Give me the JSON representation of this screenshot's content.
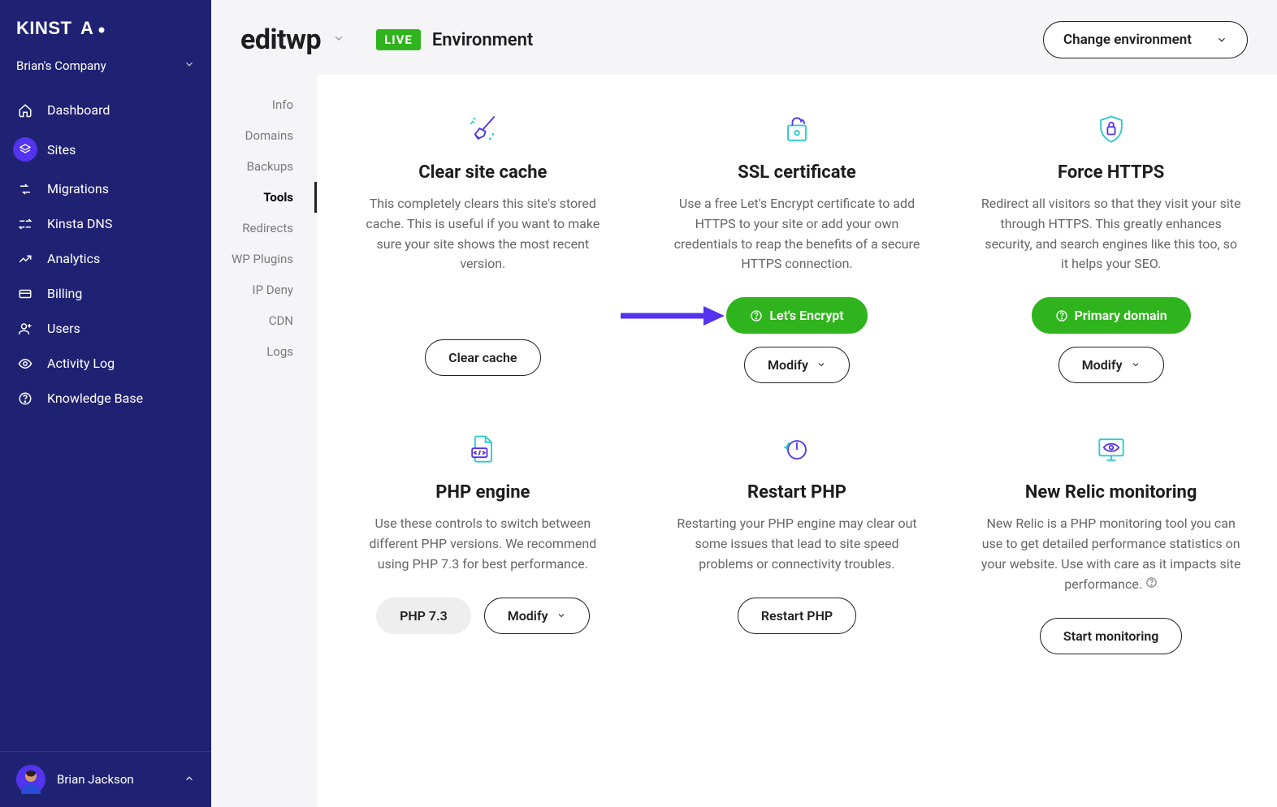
{
  "brand": "KINSTA",
  "company": {
    "name": "Brian's Company"
  },
  "nav": {
    "dashboard": "Dashboard",
    "sites": "Sites",
    "migrations": "Migrations",
    "dns": "Kinsta DNS",
    "analytics": "Analytics",
    "billing": "Billing",
    "users": "Users",
    "activity": "Activity Log",
    "kb": "Knowledge Base"
  },
  "user": {
    "name": "Brian Jackson"
  },
  "header": {
    "site_title": "editwp",
    "live_badge": "LIVE",
    "environment_label": "Environment",
    "change_env": "Change environment"
  },
  "subnav": [
    {
      "label": "Info",
      "active": false
    },
    {
      "label": "Domains",
      "active": false
    },
    {
      "label": "Backups",
      "active": false
    },
    {
      "label": "Tools",
      "active": true
    },
    {
      "label": "Redirects",
      "active": false
    },
    {
      "label": "WP Plugins",
      "active": false
    },
    {
      "label": "IP Deny",
      "active": false
    },
    {
      "label": "CDN",
      "active": false
    },
    {
      "label": "Logs",
      "active": false
    }
  ],
  "tools": {
    "clear_cache": {
      "title": "Clear site cache",
      "desc": "This completely clears this site's stored cache. This is useful if you want to make sure your site shows the most recent version.",
      "button": "Clear cache"
    },
    "ssl": {
      "title": "SSL certificate",
      "desc": "Use a free Let's Encrypt certificate to add HTTPS to your site or add your own credentials to reap the benefits of a secure HTTPS connection.",
      "primary_button": "Let's Encrypt",
      "secondary_button": "Modify"
    },
    "force_https": {
      "title": "Force HTTPS",
      "desc": "Redirect all visitors so that they visit your site through HTTPS. This greatly enhances security, and search engines like this too, so it helps your SEO.",
      "primary_button": "Primary domain",
      "secondary_button": "Modify"
    },
    "php_engine": {
      "title": "PHP engine",
      "desc": "Use these controls to switch between different PHP versions. We recommend using PHP 7.3 for best performance.",
      "chip": "PHP 7.3",
      "button": "Modify"
    },
    "restart_php": {
      "title": "Restart PHP",
      "desc": "Restarting your PHP engine may clear out some issues that lead to site speed problems or connectivity troubles.",
      "button": "Restart PHP"
    },
    "new_relic": {
      "title": "New Relic monitoring",
      "desc": "New Relic is a PHP monitoring tool you can use to get detailed performance statistics on your website. Use with care as it impacts site performance.",
      "button": "Start monitoring"
    }
  }
}
